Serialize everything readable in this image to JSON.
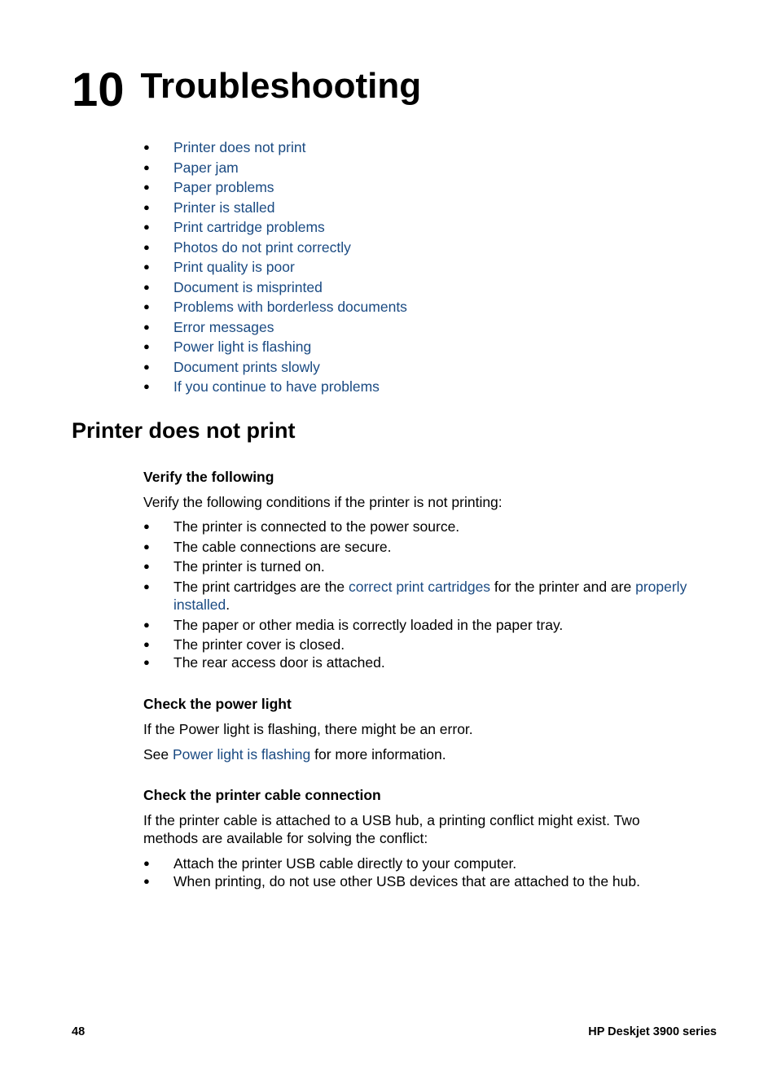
{
  "chapter": {
    "number": "10",
    "title": "Troubleshooting"
  },
  "toc": [
    "Printer does not print",
    "Paper jam",
    "Paper problems",
    "Printer is stalled",
    "Print cartridge problems",
    "Photos do not print correctly",
    "Print quality is poor",
    "Document is misprinted",
    "Problems with borderless documents",
    "Error messages",
    "Power light is flashing",
    "Document prints slowly",
    "If you continue to have problems"
  ],
  "section": {
    "title": "Printer does not print",
    "verify": {
      "heading": "Verify the following",
      "intro": "Verify the following conditions if the printer is not printing:",
      "items": [
        "The printer is connected to the power source.",
        "The cable connections are secure.",
        "The printer is turned on."
      ],
      "cartridge_item": {
        "pre": "The print cartridges are the ",
        "link1": "correct print cartridges",
        "mid": " for the printer and are ",
        "link2": "properly installed",
        "post": "."
      },
      "items2": [
        "The paper or other media is correctly loaded in the paper tray.",
        "The printer cover is closed.",
        "The rear access door is attached."
      ]
    },
    "power": {
      "heading": "Check the power light",
      "text": "If the Power light is flashing, there might be an error.",
      "see_pre": "See ",
      "see_link": "Power light is flashing",
      "see_post": " for more information."
    },
    "cable": {
      "heading": "Check the printer cable connection",
      "text": "If the printer cable is attached to a USB hub, a printing conflict might exist. Two methods are available for solving the conflict:",
      "items": [
        "Attach the printer USB cable directly to your computer.",
        "When printing, do not use other USB devices that are attached to the hub."
      ]
    }
  },
  "footer": {
    "page": "48",
    "product": "HP Deskjet 3900 series"
  },
  "bullet": "●"
}
